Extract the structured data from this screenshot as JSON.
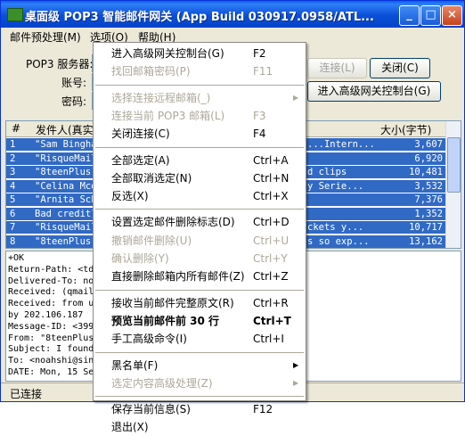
{
  "window": {
    "title": "桌面级 POP3 智能邮件网关 (App Build 030917.0958/ATL...",
    "minimize_glyph": "_",
    "maximize_glyph": "□",
    "close_glyph": "×"
  },
  "menubar": [
    "邮件预处理(M)",
    "选项(O)",
    "帮助(H)"
  ],
  "form": {
    "pop3_label": "POP3 服务器:",
    "account_label": "账号:",
    "password_label": "密码:",
    "connect_button": "连接(L)",
    "close_button": "关闭(C)",
    "console_button": "进入高级网关控制台(G)"
  },
  "table": {
    "headers": [
      "#",
      "发件人(真实",
      "大小(字节)"
    ],
    "rows": [
      {
        "num": "1",
        "from": "\"Sam Bingha",
        "mid": "...Intern...",
        "size": "3,607"
      },
      {
        "num": "2",
        "from": "\"RisqueMail",
        "mid": "",
        "size": "6,920"
      },
      {
        "num": "3",
        "from": "\"8teenPlus\"",
        "mid": "d clips",
        "size": "10,481"
      },
      {
        "num": "4",
        "from": "\"Celina Mcd",
        "mid": "y Serie...",
        "size": "3,532"
      },
      {
        "num": "5",
        "from": "\"Arnita Sch",
        "mid": "",
        "size": "7,376"
      },
      {
        "num": "6",
        "from": "Bad credit?",
        "mid": "",
        "size": "1,352"
      },
      {
        "num": "7",
        "from": "\"RisqueMail",
        "mid": "ckets y...",
        "size": "10,717"
      },
      {
        "num": "8",
        "from": "\"8teenPlus\"",
        "mid": "s so exp...",
        "size": "13,162"
      }
    ]
  },
  "log": [
    "+OK",
    "Return-Path: <td",
    "Delivered-To: no",
    "Received: (qmail                                     03 04:28:01 -0000",
    "Received: from u                                     (198.65.163.20)",
    "  by 202.106.187                                     ",
    "Message-ID: <399                                     lbox.com>",
    "From: \"8teenPlus",
    "Subject: I found",
    "To: <noahshi@sin",
    "DATE: Mon, 15 Se"
  ],
  "status": "已连接",
  "dropdown": [
    {
      "label": "进入高级网关控制台(G)",
      "shortcut": "F2",
      "disabled": false,
      "bold": false,
      "submenu": false
    },
    {
      "label": "找回邮箱密码(P)",
      "shortcut": "F11",
      "disabled": true,
      "bold": false,
      "submenu": false
    },
    {
      "sep": true
    },
    {
      "label": "选择连接远程邮箱(_)",
      "shortcut": "",
      "disabled": true,
      "bold": false,
      "submenu": true
    },
    {
      "label": "连接当前 POP3 邮箱(L)",
      "shortcut": "F3",
      "disabled": true,
      "bold": false,
      "submenu": false
    },
    {
      "label": "关闭连接(C)",
      "shortcut": "F4",
      "disabled": false,
      "bold": false,
      "submenu": false
    },
    {
      "sep": true
    },
    {
      "label": "全部选定(A)",
      "shortcut": "Ctrl+A",
      "disabled": false,
      "bold": false,
      "submenu": false
    },
    {
      "label": "全部取消选定(N)",
      "shortcut": "Ctrl+N",
      "disabled": false,
      "bold": false,
      "submenu": false
    },
    {
      "label": "反选(X)",
      "shortcut": "Ctrl+X",
      "disabled": false,
      "bold": false,
      "submenu": false
    },
    {
      "sep": true
    },
    {
      "label": "设置选定邮件删除标志(D)",
      "shortcut": "Ctrl+D",
      "disabled": false,
      "bold": false,
      "submenu": false
    },
    {
      "label": "撤销邮件删除(U)",
      "shortcut": "Ctrl+U",
      "disabled": true,
      "bold": false,
      "submenu": false
    },
    {
      "label": "确认删除(Y)",
      "shortcut": "Ctrl+Y",
      "disabled": true,
      "bold": false,
      "submenu": false
    },
    {
      "label": "直接删除邮箱内所有邮件(Z)",
      "shortcut": "Ctrl+Z",
      "disabled": false,
      "bold": false,
      "submenu": false
    },
    {
      "sep": true
    },
    {
      "label": "接收当前邮件完整原文(R)",
      "shortcut": "Ctrl+R",
      "disabled": false,
      "bold": false,
      "submenu": false
    },
    {
      "label": "预览当前邮件前 30 行",
      "shortcut": "Ctrl+T",
      "disabled": false,
      "bold": true,
      "submenu": false
    },
    {
      "label": "手工高级命令(I)",
      "shortcut": "Ctrl+I",
      "disabled": false,
      "bold": false,
      "submenu": false
    },
    {
      "sep": true
    },
    {
      "label": "黑名单(F)",
      "shortcut": "",
      "disabled": false,
      "bold": false,
      "submenu": true
    },
    {
      "label": "选定内容高级处理(Z)",
      "shortcut": "",
      "disabled": true,
      "bold": false,
      "submenu": true
    },
    {
      "sep": true
    },
    {
      "label": "保存当前信息(S)",
      "shortcut": "F12",
      "disabled": false,
      "bold": false,
      "submenu": false
    },
    {
      "label": "退出(X)",
      "shortcut": "",
      "disabled": false,
      "bold": false,
      "submenu": false
    }
  ]
}
